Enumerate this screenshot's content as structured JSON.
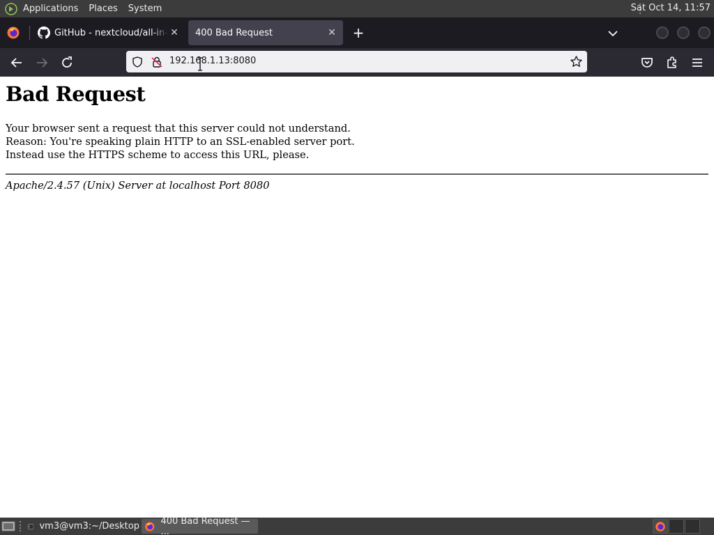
{
  "top_panel": {
    "menus": [
      "Applications",
      "Places",
      "System"
    ],
    "clock": "Sat Oct 14, 11:57"
  },
  "browser": {
    "tabs": [
      {
        "label": "GitHub - nextcloud/all-in-one",
        "active": false,
        "icon": "github-icon"
      },
      {
        "label": "400 Bad Request",
        "active": true,
        "icon": ""
      }
    ],
    "url": "192.168.1.13:8080"
  },
  "page": {
    "heading": "Bad Request",
    "lines": [
      "Your browser sent a request that this server could not understand.",
      "Reason: You're speaking plain HTTP to an SSL-enabled server port.",
      "Instead use the HTTPS scheme to access this URL, please."
    ],
    "address": "Apache/2.4.57 (Unix) Server at localhost Port 8080"
  },
  "taskbar": {
    "tasks": [
      {
        "label": "vm3@vm3:~/Desktop",
        "icon": "terminal-icon",
        "active": false
      },
      {
        "label": "400 Bad Request — ...",
        "icon": "firefox-icon",
        "active": true
      }
    ]
  },
  "colors": {
    "panel_bg": "#3c3c3c",
    "tabstrip_bg": "#1c1b22",
    "active_tab_bg": "#42414d",
    "navbar_bg": "#2b2a33",
    "urlbar_bg": "#f0f0f4"
  }
}
